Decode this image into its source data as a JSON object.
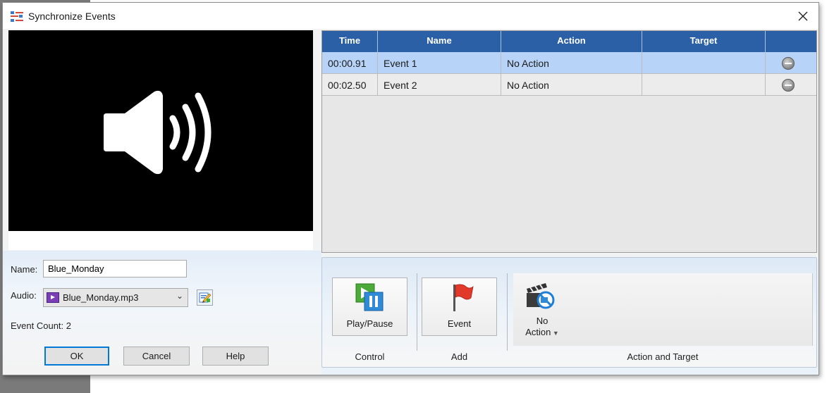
{
  "window": {
    "title": "Synchronize Events"
  },
  "form": {
    "name_label": "Name:",
    "name_value": "Blue_Monday",
    "audio_label": "Audio:",
    "audio_value": "Blue_Monday.mp3",
    "event_count_label": "Event Count: 2"
  },
  "buttons": {
    "ok": "OK",
    "cancel": "Cancel",
    "help": "Help"
  },
  "table": {
    "columns": [
      "Time",
      "Name",
      "Action",
      "Target"
    ],
    "rows": [
      {
        "time": "00:00.91",
        "name": "Event 1",
        "action": "No Action",
        "target": "",
        "selected": true
      },
      {
        "time": "00:02.50",
        "name": "Event 2",
        "action": "No Action",
        "target": "",
        "selected": false
      }
    ]
  },
  "ribbon": {
    "play_pause_label": "Play/Pause",
    "event_label": "Event",
    "no_action_line1": "No",
    "no_action_line2": "Action",
    "groups": {
      "control": "Control",
      "add": "Add",
      "action_target": "Action and Target"
    }
  },
  "colors": {
    "header_blue": "#2c60a6",
    "selected_row": "#b7d4f8",
    "preview_bg": "#000000"
  },
  "icons": [
    "app-icon",
    "close-icon",
    "speaker-icon",
    "mp3-file-icon",
    "edit-icon",
    "play-pause-icon",
    "flag-icon",
    "clapper-no-action-icon",
    "remove-icon"
  ]
}
